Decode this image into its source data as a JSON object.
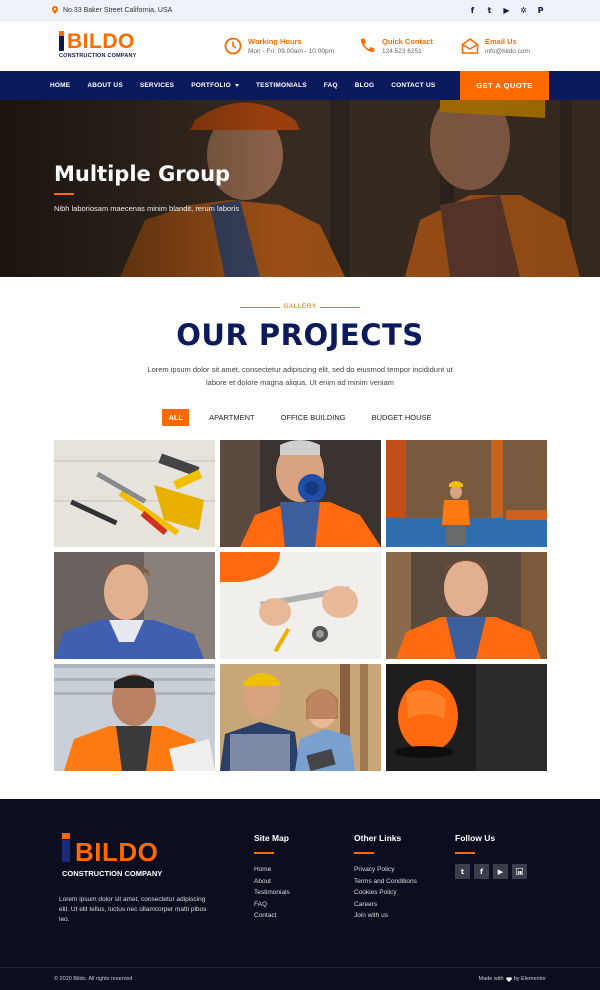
{
  "topbar": {
    "address": "No 33 Baker Street California, USA",
    "socials": [
      {
        "icon": "facebook-icon",
        "glyph": "f"
      },
      {
        "icon": "twitter-icon",
        "glyph": "t"
      },
      {
        "icon": "youtube-icon",
        "glyph": "▶"
      },
      {
        "icon": "yelp-icon",
        "glyph": "✲"
      },
      {
        "icon": "pinterest-icon",
        "glyph": "P"
      }
    ]
  },
  "brand": {
    "name": "BILDO",
    "tagline": "CONSTRUCTION COMPANY",
    "accent": "#ff6a00",
    "navy": "#0b1a5c"
  },
  "header": {
    "hours": {
      "title": "Working Hours",
      "value": "Mon - Fri: 09.00am - 10.00pm"
    },
    "contact": {
      "title": "Quick Contact",
      "value": "124 523 6251"
    },
    "email": {
      "title": "Email Us",
      "value": "info@bildo.com"
    }
  },
  "nav": {
    "items": [
      "HOME",
      "ABOUT US",
      "SERVICES",
      "PORTFOLIO",
      "TESTIMONIALS",
      "FAQ",
      "BLOG",
      "CONTACT US"
    ],
    "quote_label": "GET A QUOTE"
  },
  "hero": {
    "title": "Multiple Group",
    "subtitle": "Nibh laboriosam maecenas minim blandit, rerum laboris"
  },
  "projects": {
    "tag": "GALLERY",
    "title": "OUR PROJECTS",
    "description": "Lorem ipsum dolor sit amet, consectetur adipiscing elit, sed do eiusmod tempor incididunt ut labore et dolore magna aliqua. Ut enim ad minim veniam",
    "filters": [
      "ALL",
      "APARTMENT",
      "OFFICE BUILDING",
      "BUDGET HOUSE"
    ],
    "active_filter": "ALL"
  },
  "footer": {
    "description": "Lorem ipsum dolor sit amet, consectetur adipiscing elit. Ut elit tellus, luctus nec ullamcorper matti pibus leo.",
    "sitemap": {
      "title": "Site Map",
      "links": [
        "Home",
        "About",
        "Testimonials",
        "FAQ",
        "Contact"
      ]
    },
    "other": {
      "title": "Other Links",
      "links": [
        "Privacy Policy",
        "Terms and Conditions",
        "Cookies Policy",
        "Careers",
        "Join with us"
      ]
    },
    "follow": {
      "title": "Follow Us"
    },
    "copyright": "© 2020 Bildo. All rights reserved",
    "made_with_pre": "Made with",
    "made_with_post": "by Elementor"
  }
}
